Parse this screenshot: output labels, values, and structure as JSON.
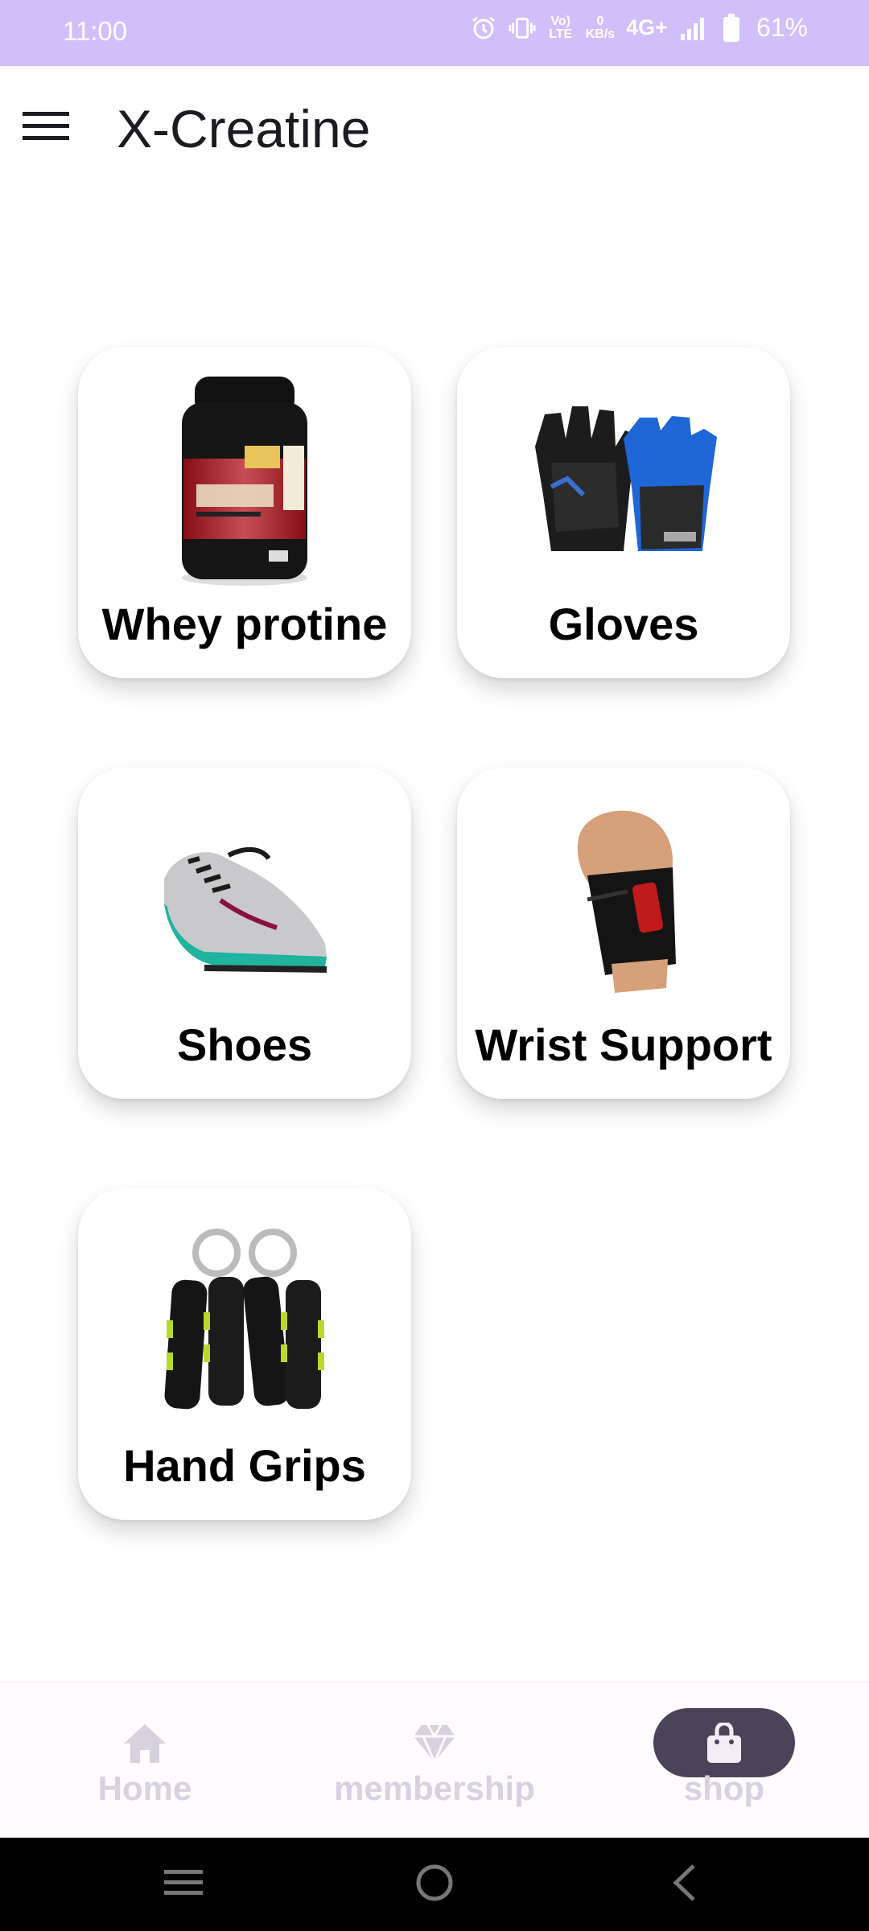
{
  "status_bar": {
    "time": "11:00",
    "volte_label": "Vo) LTE",
    "speed_value": "0",
    "speed_unit": "KB/s",
    "network": "4G+",
    "battery": "61%",
    "icons": [
      "alarm-icon",
      "vibrate-icon",
      "volte-icon",
      "signal-icon",
      "battery-icon"
    ]
  },
  "app_bar": {
    "title": "X-Creatine",
    "menu_icon": "hamburger-menu-icon"
  },
  "categories": [
    {
      "label": "Whey protine",
      "icon": "whey-protein-tub-image"
    },
    {
      "label": "Gloves",
      "icon": "gym-gloves-image"
    },
    {
      "label": "Shoes",
      "icon": "running-shoe-image"
    },
    {
      "label": "Wrist Support",
      "icon": "wrist-support-image"
    },
    {
      "label": "Hand Grips",
      "icon": "hand-grips-image"
    }
  ],
  "bottom_nav": {
    "items": [
      {
        "label": "Home",
        "icon": "home-icon",
        "selected": false
      },
      {
        "label": "membership",
        "icon": "diamond-icon",
        "selected": false
      },
      {
        "label": "shop",
        "icon": "shopping-bag-icon",
        "selected": true
      }
    ],
    "colors": {
      "inactive": "#d7d1e0",
      "indicator": "#4a4458",
      "selected_icon": "#f3edf7"
    }
  },
  "system_nav": {
    "buttons": [
      "recents-icon",
      "home-circle-icon",
      "back-icon"
    ]
  },
  "colors": {
    "status_bar": "#d2befa",
    "background": "#ffffff",
    "title": "#1d1b20"
  }
}
